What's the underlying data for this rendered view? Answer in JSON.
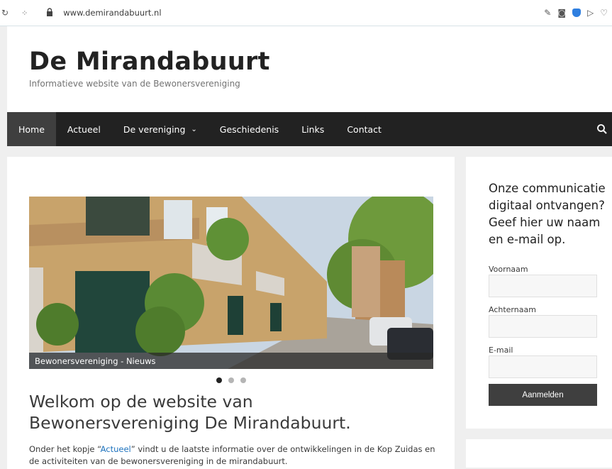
{
  "browser": {
    "url": "www.demirandabuurt.nl"
  },
  "site": {
    "title": "De Mirandabuurt",
    "description": "Informatieve website van de Bewonersvereniging"
  },
  "nav": {
    "items": [
      "Home",
      "Actueel",
      "De vereniging",
      "Geschiedenis",
      "Links",
      "Contact"
    ],
    "active": "Home"
  },
  "slider": {
    "caption": "Bewonersvereniging - Nieuws",
    "slide_count": 3,
    "active_slide": 1
  },
  "main": {
    "heading": "Welkom op de website van Bewonersvereniging De Mirandabuurt.",
    "intro_before": "Onder het kopje “",
    "intro_link": "Actueel",
    "intro_after": "” vindt u de laatste informatie over de ontwikkelingen in de Kop Zuidas en de activiteiten van de bewonersvereniging in de mirandabuurt."
  },
  "signup": {
    "heading": "Onze communicatie digitaal ontvangen? Geef hier uw naam en e-mail op.",
    "first_name_label": "Voornaam",
    "last_name_label": "Achternaam",
    "email_label": "E-mail",
    "submit_label": "Aanmelden"
  },
  "colors": {
    "nav_bg": "#222222",
    "nav_active": "#3f3f3f",
    "link": "#1e73be",
    "page_bg": "#efefef"
  }
}
